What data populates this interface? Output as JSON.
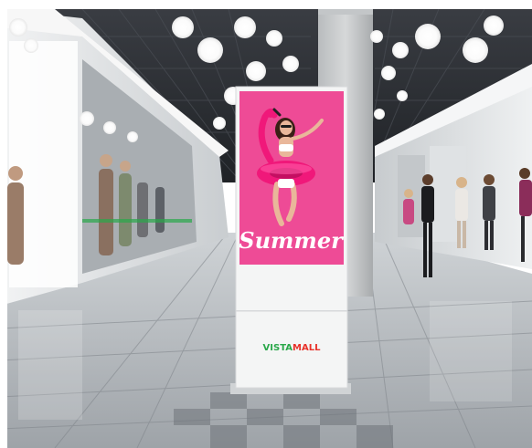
{
  "kiosk": {
    "screen_text": "Summer",
    "brand_part1": "VISTA",
    "brand_part2": "MALL"
  },
  "colors": {
    "screen_pink": "#ee4b96",
    "flamingo": "#f0187a",
    "brand_green": "#2aa84a",
    "brand_red": "#e8322a",
    "floor_light": "#d9dcdf",
    "floor_dark": "#8d9196",
    "ceiling": "#2c2f34"
  }
}
